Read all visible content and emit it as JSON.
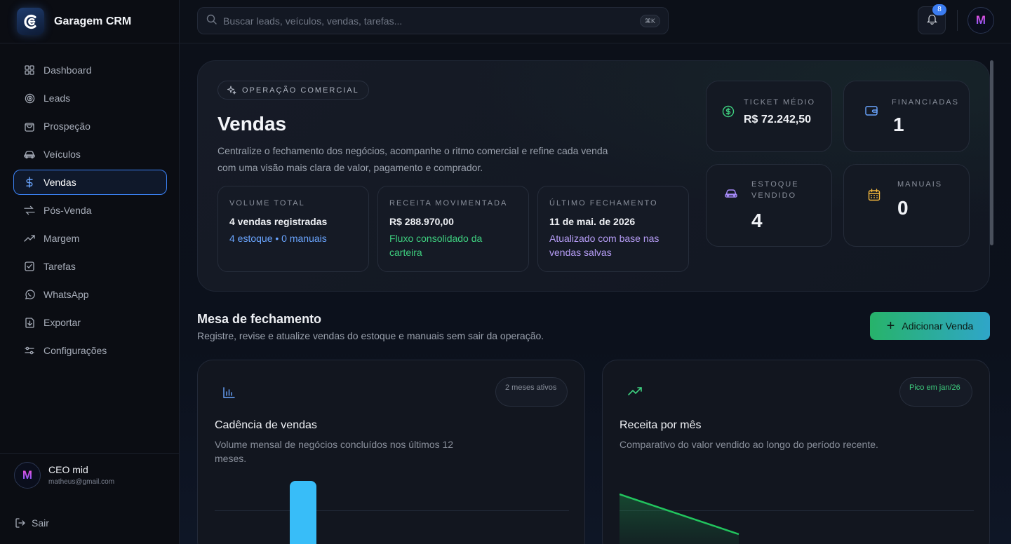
{
  "brand": {
    "name": "Garagem CRM"
  },
  "search": {
    "placeholder": "Buscar leads, veículos, vendas, tarefas...",
    "shortcut": "⌘K"
  },
  "notifications": {
    "count": "8"
  },
  "nav": {
    "items": [
      {
        "label": "Dashboard",
        "icon": "grid-icon"
      },
      {
        "label": "Leads",
        "icon": "target-icon"
      },
      {
        "label": "Prospeção",
        "icon": "bag-icon"
      },
      {
        "label": "Veículos",
        "icon": "car-icon"
      },
      {
        "label": "Vendas",
        "icon": "dollar-icon",
        "active": true
      },
      {
        "label": "Pós-Venda",
        "icon": "repeat-icon"
      },
      {
        "label": "Margem",
        "icon": "trend-icon"
      },
      {
        "label": "Tarefas",
        "icon": "check-square-icon"
      },
      {
        "label": "WhatsApp",
        "icon": "whatsapp-icon"
      },
      {
        "label": "Exportar",
        "icon": "download-icon"
      },
      {
        "label": "Configurações",
        "icon": "sliders-icon"
      }
    ]
  },
  "user": {
    "initial": "M",
    "name": "CEO mid",
    "email": "matheus@gmail.com"
  },
  "logout": {
    "label": "Sair"
  },
  "hero": {
    "pill": "OPERAÇÃO COMERCIAL",
    "title": "Vendas",
    "description": "Centralize o fechamento dos negócios, acompanhe o ritmo comercial e refine cada venda com uma visão mais clara de valor, pagamento e comprador.",
    "cards": [
      {
        "label": "VOLUME TOTAL",
        "value": "4 vendas registradas",
        "sub": "4 estoque • 0 manuais",
        "sub_color": "#6aa5ff"
      },
      {
        "label": "RECEITA MOVIMENTADA",
        "value": "R$ 288.970,00",
        "sub": "Fluxo consolidado da carteira",
        "sub_color": "#3ecf7f"
      },
      {
        "label": "ÚLTIMO FECHAMENTO",
        "value": "11 de mai. de 2026",
        "sub": "Atualizado com base nas vendas salvas",
        "sub_color": "#b59cf5"
      }
    ]
  },
  "stats": [
    {
      "label": "TICKET MÉDIO",
      "value": "R$ 72.242,50",
      "icon": "dollar-circle-icon",
      "color": "#3ecf7f"
    },
    {
      "label": "FINANCIADAS",
      "value": "1",
      "icon": "wallet-icon",
      "color": "#6aa5ff"
    },
    {
      "label": "ESTOQUE VENDIDO",
      "value": "4",
      "icon": "car-icon",
      "color": "#a78bfa"
    },
    {
      "label": "MANUAIS",
      "value": "0",
      "icon": "calendar-icon",
      "color": "#f5b83d"
    }
  ],
  "section": {
    "title": "Mesa de fechamento",
    "subtitle": "Registre, revise e atualize vendas do estoque e manuais sem sair da operação.",
    "add_button": "Adicionar Venda"
  },
  "panels": {
    "cadence": {
      "tag": "2 meses ativos",
      "title": "Cadência de vendas",
      "subtitle": "Volume mensal de negócios concluídos nos últimos 12 meses.",
      "accent": "#38bdf8"
    },
    "revenue": {
      "tag": "Pico em jan/26",
      "title": "Receita por mês",
      "subtitle": "Comparativo do valor vendido ao longo do período recente.",
      "accent": "#22c55e"
    }
  }
}
